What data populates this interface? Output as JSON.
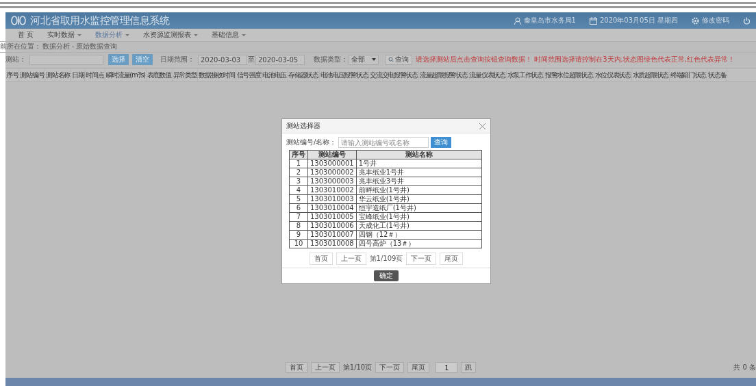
{
  "header": {
    "title": "河北省取用水监控管理信息系统",
    "user": "秦皇岛市水务局1",
    "date": "2020年03月05日 星期四",
    "change_password": "修改密码"
  },
  "nav": [
    {
      "label": "首 页",
      "dropdown": false,
      "selected": false
    },
    {
      "label": "实时数据",
      "dropdown": true,
      "selected": false
    },
    {
      "label": "数据分析",
      "dropdown": true,
      "selected": true
    },
    {
      "label": "水资源监测报表",
      "dropdown": true,
      "selected": false
    },
    {
      "label": "基础信息",
      "dropdown": true,
      "selected": false
    }
  ],
  "breadcrumb": {
    "label": "前所在位置：",
    "path": "数据分析 - 原始数据查询"
  },
  "toolbar": {
    "station_label": "测站：",
    "select_button": "选择",
    "clear_button": "清空",
    "date_label": "日期范围：",
    "date_from": "2020-03-03",
    "date_sep": "至",
    "date_to": "2020-03-05",
    "type_label": "数据类型：",
    "type_value": "全部",
    "query_button": "查询",
    "warning": "请选择测站后点击查询按钮查询数据！ 时间范围选择请控制在3天内,状态图绿色代表正常,红色代表异常！"
  },
  "table": {
    "columns": [
      "序号",
      "测站编号",
      "测站名称",
      "日期",
      "时间点",
      "瞬时流量(m³/s)",
      "表底数值",
      "异常类型",
      "数据接收时间",
      "信号强度",
      "电池电压",
      "存储器状态",
      "电池电压报警状态",
      "交流交电报警状态",
      "流量超限报警状态",
      "流量仪表状态",
      "水泵工作状态",
      "报警水位超限状态",
      "水位仪表状态",
      "水质超限状态",
      "终端箱门状态",
      "状态备"
    ]
  },
  "pager": {
    "buttons": [
      "首页",
      "上一页"
    ],
    "page_info": "第1/10页",
    "buttons_after": [
      "下一页",
      "尾页"
    ],
    "page_input": "1",
    "go_button": "跳",
    "total": "共 0 条"
  },
  "dialog": {
    "title": "测站选择器",
    "search_label": "测站编号/名称：",
    "search_placeholder": "请输入测站编号或名称",
    "search_button": "查询",
    "columns": [
      "序号",
      "测站编号",
      "测站名称"
    ],
    "rows": [
      [
        "1",
        "1303000001",
        "1号井"
      ],
      [
        "2",
        "1303000002",
        "兆丰纸业1号井"
      ],
      [
        "3",
        "1303000003",
        "兆丰纸业3号井"
      ],
      [
        "4",
        "1303010002",
        "前畔纸业(1号井)"
      ],
      [
        "5",
        "1303010003",
        "华云纸业(1号井)"
      ],
      [
        "6",
        "1303010004",
        "恒宇造纸厂(1号井)"
      ],
      [
        "7",
        "1303010005",
        "宝峰纸业(1号井)"
      ],
      [
        "8",
        "1303010006",
        "天成化工(1号井)"
      ],
      [
        "9",
        "1303010007",
        "四钢（12＃）"
      ],
      [
        "10",
        "1303010008",
        "四号高炉（13＃）"
      ]
    ],
    "pager": {
      "first": "首页",
      "prev": "上一页",
      "page_info": "第1/109页",
      "next": "下一页",
      "last": "尾页"
    },
    "confirm_button": "确定"
  }
}
